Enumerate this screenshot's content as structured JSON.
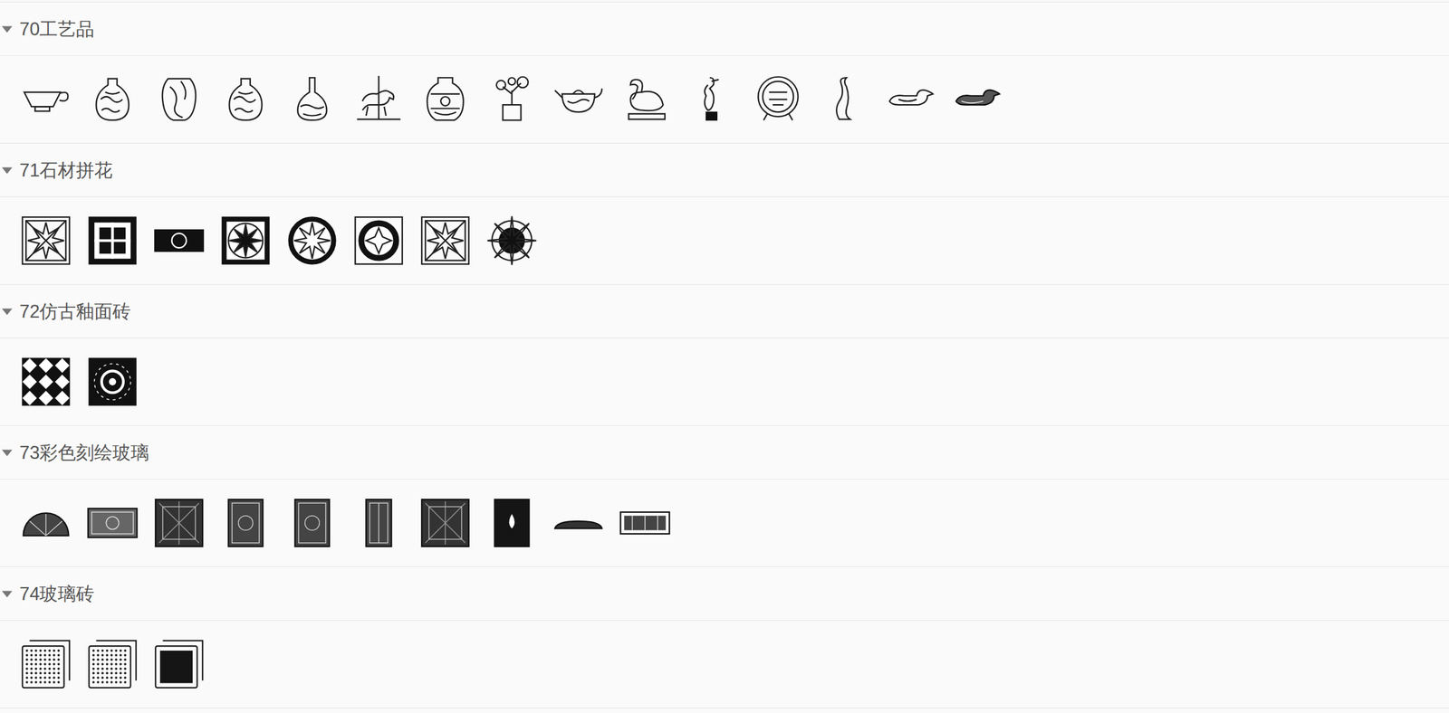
{
  "sections": [
    {
      "title": "70工艺品",
      "expanded": true,
      "items": [
        {
          "kind": "bowl"
        },
        {
          "kind": "vase"
        },
        {
          "kind": "jar-tall"
        },
        {
          "kind": "vase"
        },
        {
          "kind": "bottle"
        },
        {
          "kind": "horse"
        },
        {
          "kind": "jar"
        },
        {
          "kind": "bonsai"
        },
        {
          "kind": "teapot"
        },
        {
          "kind": "swan"
        },
        {
          "kind": "crane"
        },
        {
          "kind": "plate"
        },
        {
          "kind": "bird"
        },
        {
          "kind": "duck"
        },
        {
          "kind": "duck-dark"
        }
      ]
    },
    {
      "title": "71石材拼花",
      "expanded": true,
      "items": [
        {
          "kind": "square-star"
        },
        {
          "kind": "square-grid"
        },
        {
          "kind": "strip"
        },
        {
          "kind": "square-compass"
        },
        {
          "kind": "round-star"
        },
        {
          "kind": "square-circle"
        },
        {
          "kind": "square-star"
        },
        {
          "kind": "round-compass"
        }
      ]
    },
    {
      "title": "72仿古釉面砖",
      "expanded": true,
      "items": [
        {
          "kind": "tile-pattern"
        },
        {
          "kind": "tile-circle"
        }
      ]
    },
    {
      "title": "73彩色刻绘玻璃",
      "expanded": true,
      "items": [
        {
          "kind": "arc"
        },
        {
          "kind": "panel-wide"
        },
        {
          "kind": "panel"
        },
        {
          "kind": "panel-mid"
        },
        {
          "kind": "panel-mid"
        },
        {
          "kind": "panel-narrow"
        },
        {
          "kind": "panel"
        },
        {
          "kind": "panel-dark"
        },
        {
          "kind": "arc-flat"
        },
        {
          "kind": "panel-strip"
        }
      ]
    },
    {
      "title": "74玻璃砖",
      "expanded": true,
      "items": [
        {
          "kind": "glass-dots"
        },
        {
          "kind": "glass-dots"
        },
        {
          "kind": "glass-dark"
        }
      ]
    }
  ]
}
